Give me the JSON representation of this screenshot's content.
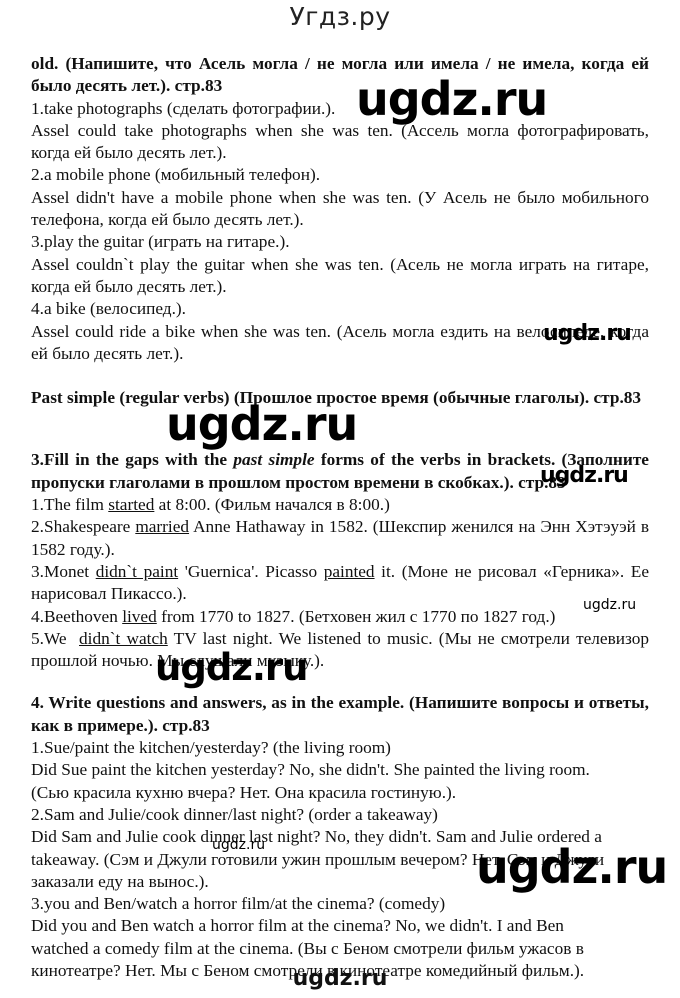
{
  "site_title": "Угдз.ру",
  "watermark": "ugdz.ru",
  "section1": {
    "heading": "old. (Напишите, что Асель могла / не могла или имела / не имела, когда ей было десять лет.). стр.83",
    "items": [
      {
        "prompt": "1.take photographs (сделать фотографии.).",
        "answer": "Assel could take photographs when she was ten. (Ассель могла фотографировать, когда ей было десять лет.)."
      },
      {
        "prompt": "2.a mobile phone (мобильный телефон).",
        "answer": "Assel didn't have a mobile phone when she was ten. (У Асель не было мобильного телефона, когда ей было десять лет.)."
      },
      {
        "prompt": "3.play the guitar (играть на гитаре.).",
        "answer": "Assel couldn`t play the guitar when she was ten. (Асель не могла играть на гитаре, когда ей было десять лет.)."
      },
      {
        "prompt": "4.a bike (велосипед.).",
        "answer": "Assel could ride a bike when she was ten. (Асель могла ездить на велосипеде, когда ей было десять лет.)."
      }
    ]
  },
  "section2": {
    "heading": "Past simple (regular verbs) (Прошлое простое время (обычные глаголы). стр.83"
  },
  "section3": {
    "heading_pre": "3.Fill in the gaps with the ",
    "heading_italic": "past simple",
    "heading_post": " forms of the verbs in brackets. (Заполните пропуски глаголами в прошлом простом времени в скобках.). стр.83",
    "items": [
      {
        "a": "1.The film ",
        "u1": "started",
        "b": " at 8:00. (Фильм начался в 8:00.)"
      },
      {
        "a": "2.Shakespeare ",
        "u1": "married",
        "b": " Anne Hathaway in 1582. (Шекспир женился на Энн Хэтэуэй в 1582 году.)."
      },
      {
        "a": "3.Monet ",
        "u1": "didn`t paint",
        "b": " 'Guernica'. Picasso ",
        "u2": "painted",
        "c": " it. (Моне не рисовал «Герника». Ее нарисовал Пикассо.)."
      },
      {
        "a": "4.Beethoven ",
        "u1": "lived",
        "b": " from 1770 to 1827. (Бетховен жил с 1770 по 1827 год.)"
      },
      {
        "a": "5.We  ",
        "u1": "didn`t watch",
        "b": " TV last night. We listened to music. (Мы не смотрели телевизор прошлой ночью. Мы слушали музыку.)."
      }
    ]
  },
  "section4": {
    "heading": "4. Write questions and answers, as in the example. (Напишите вопросы и ответы, как в примере.). стр.83",
    "items": [
      {
        "prompt": "1.Sue/paint the kitchen/yesterday? (the living room)",
        "lines": [
          "Did Sue paint the kitchen yesterday? No, she didn't. She painted the living room.",
          "(Сью красила кухню вчера? Нет. Она красила гостиную.)."
        ]
      },
      {
        "prompt": "2.Sam and Julie/cook dinner/last night? (order a takeaway)",
        "lines": [
          "Did Sam and Julie cook dinner last night? No, they didn't. Sam and Julie ordered a",
          "takeaway. (Сэм и Джули готовили ужин прошлым вечером? Нет. Сэм и Джули",
          "заказали еду на вынос.)."
        ]
      },
      {
        "prompt": "3.you and Ben/watch a horror film/at the cinema? (comedy)",
        "lines": [
          "Did you and Ben watch a horror film at the cinema? No, we didn't. I and Ben",
          "watched a comedy film at the cinema. (Вы с Беном смотрели фильм ужасов в",
          "кинотеатре? Нет. Мы с Беном смотрели в кинотеатре комедийный фильм.)."
        ]
      }
    ]
  }
}
